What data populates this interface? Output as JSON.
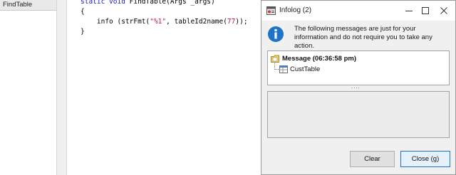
{
  "tree": {
    "selected_item": "FindTable"
  },
  "code": {
    "line1_kw": "static void",
    "line1_rest": " FindTable(Args _args)",
    "open_brace": "{",
    "line3_indent": "    info (strFmt(",
    "line3_str": "\"%1\"",
    "line3_mid": ", tableId2name(",
    "line3_num": "77",
    "line3_end": "));",
    "close_brace": "}"
  },
  "infolog": {
    "title": "Infolog (2)",
    "message": "The following messages are just for your information and do not require you to take any action.",
    "header_label": "Message (06:36:58 pm)",
    "child_label": "CustTable",
    "splitter": "....",
    "clear_button": "Clear",
    "close_button": "Close (g)"
  },
  "icons": [
    "infolog-app-icon",
    "minimize-icon",
    "maximize-icon",
    "close-icon",
    "info-icon",
    "message-folder-icon",
    "table-icon"
  ],
  "colors": {
    "keyword": "#1a1ab8",
    "string": "#b5135b",
    "info_blue": "#1e73c8",
    "default_button_border": "#1f72c6"
  }
}
